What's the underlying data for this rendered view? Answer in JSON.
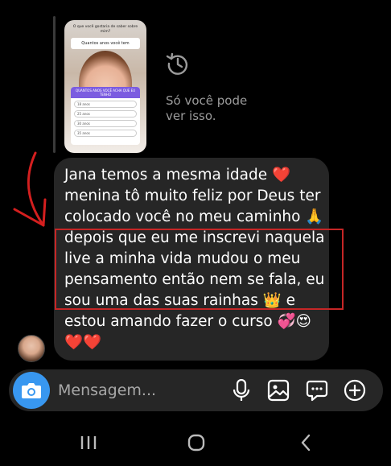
{
  "story": {
    "question": "O que você gostaria de saber sobre mim?",
    "sticker_text": "Quantos anos você tem",
    "poll_header": "QUANTOS ANOS VOCÊ ACHA QUE EU TENHO",
    "poll_options": [
      "18 anos",
      "25 anos",
      "30 anos",
      "35 anos"
    ]
  },
  "notice": {
    "icon": "history-icon",
    "text": "Só você pode ver isso."
  },
  "message": {
    "text": "Jana temos a mesma idade ❤️ menina tô muito feliz por Deus ter colocado você no meu caminho 🙏 depois que eu me inscrevi naquela live a minha vida mudou o meu pensamento então nem se fala, eu sou uma das suas rainhas 👑 e estou amando fazer o curso 💞😍❤️❤️"
  },
  "composer": {
    "placeholder": "Mensagem..."
  },
  "colors": {
    "accent": "#3897f0",
    "bubble": "#262626",
    "annotation": "#c62626"
  }
}
